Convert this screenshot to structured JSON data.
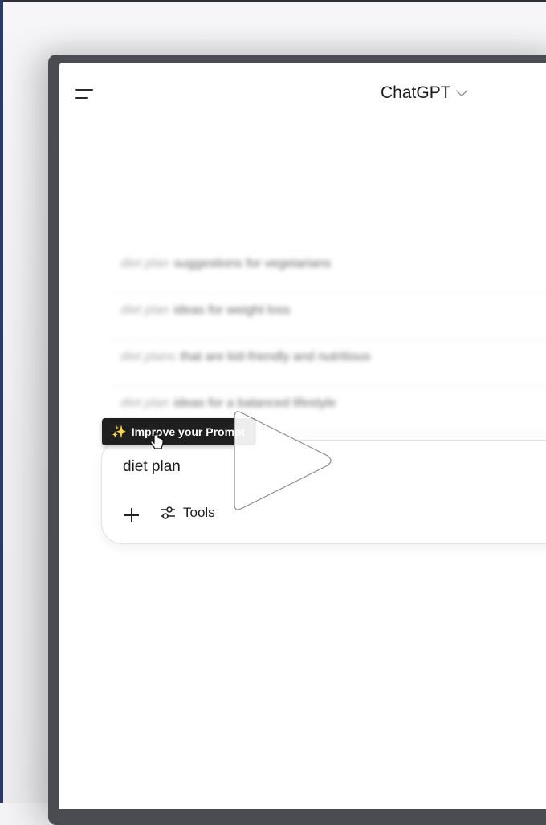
{
  "header": {
    "title": "ChatGPT"
  },
  "suggestions": [
    {
      "prefix": "diet plan",
      "text": "suggestions for vegetarians"
    },
    {
      "prefix": "diet plan",
      "text": "ideas for weight loss"
    },
    {
      "prefix": "diet plans",
      "text": "that are kid-friendly and nutritious"
    },
    {
      "prefix": "diet plan",
      "text": "ideas for a balanced lifestyle"
    }
  ],
  "tooltip": {
    "label": "Improve your Prompt"
  },
  "composer": {
    "input_value": "diet plan",
    "tools_label": "Tools"
  },
  "icons": {
    "menu": "menu-icon",
    "chevron": "chevron-down-icon",
    "plus": "plus-icon",
    "tools": "sliders-icon",
    "sparkle": "sparkle-icon",
    "cursor": "hand-pointer-icon",
    "play": "play-icon"
  }
}
